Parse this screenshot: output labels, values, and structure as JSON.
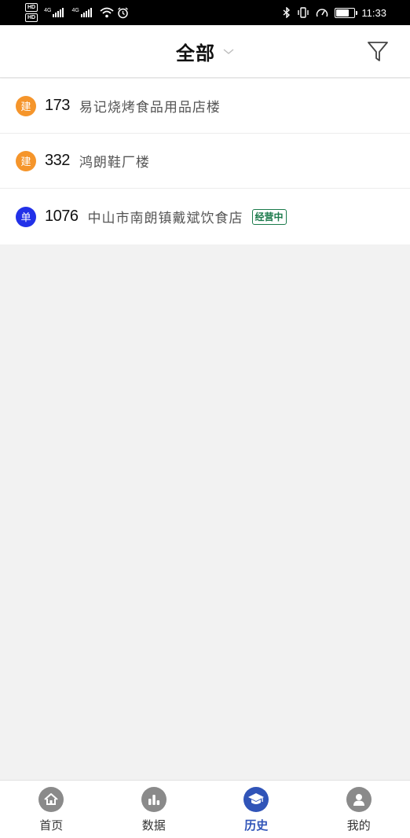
{
  "status_bar": {
    "hd1": "HD",
    "hd2": "HD",
    "net1": "4G",
    "net2": "4G",
    "time": "11:33",
    "battery_level": 0.8
  },
  "header": {
    "title": "全部",
    "filter_icon": "filter-icon",
    "dropdown_icon": "chevron-down-icon"
  },
  "list": [
    {
      "badge": "建",
      "badge_color": "#f5952b",
      "number": "173",
      "name": "易记烧烤食品用品店楼",
      "status": ""
    },
    {
      "badge": "建",
      "badge_color": "#f5952b",
      "number": "332",
      "name": "鸿朗鞋厂楼",
      "status": ""
    },
    {
      "badge": "单",
      "badge_color": "#2231e8",
      "number": "1076",
      "name": "中山市南朗镇戴斌饮食店",
      "status": "经营中"
    }
  ],
  "nav": {
    "active_color": "#3054b8",
    "inactive_color": "#8a8a8a",
    "items": [
      {
        "label": "首页",
        "icon": "home-icon",
        "active": false
      },
      {
        "label": "数据",
        "icon": "bar-chart-icon",
        "active": false
      },
      {
        "label": "历史",
        "icon": "graduation-cap-icon",
        "active": true
      },
      {
        "label": "我的",
        "icon": "user-icon",
        "active": false
      }
    ]
  }
}
